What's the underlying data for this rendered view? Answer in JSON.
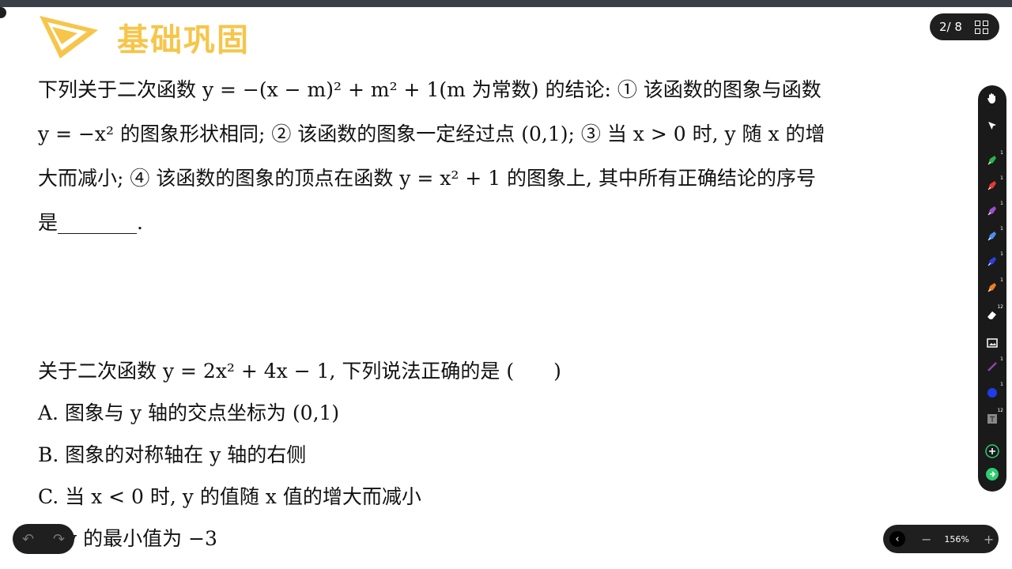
{
  "header": {
    "section_title": "基础巩固",
    "page_indicator": "2/ 8"
  },
  "question1": {
    "lines": [
      "下列关于二次函数 y = −(x − m)² + m² + 1(m 为常数) 的结论: ① 该函数的图象与函数",
      "y = −x² 的图象形状相同; ② 该函数的图象一定经过点 (0,1); ③ 当 x > 0 时, y 随 x 的增",
      "大而减小; ④ 该函数的图象的顶点在函数 y = x² + 1 的图象上, 其中所有正确结论的序号",
      "是________."
    ]
  },
  "question2": {
    "stem": "关于二次函数 y = 2x² + 4x − 1, 下列说法正确的是 (　　)",
    "options": [
      "A. 图象与 y 轴的交点坐标为 (0,1)",
      "B. 图象的对称轴在 y 轴的右侧",
      "C. 当 x < 0 时, y 的值随 x 值的增大而减小",
      "D. y 的最小值为 −3"
    ]
  },
  "tools": [
    {
      "name": "hand-tool",
      "icon": "hand-icon",
      "color": "#ffffff",
      "badge": ""
    },
    {
      "name": "select-tool",
      "icon": "pointer-icon",
      "color": "#ffffff",
      "badge": ""
    },
    {
      "name": "pen-green",
      "icon": "pen-icon",
      "color": "#2bb24c",
      "badge": "1"
    },
    {
      "name": "pen-red",
      "icon": "pen-icon",
      "color": "#e53935",
      "badge": "1"
    },
    {
      "name": "pen-purple",
      "icon": "pen-icon",
      "color": "#9c4dcc",
      "badge": "1"
    },
    {
      "name": "pen-lightblue",
      "icon": "pen-icon",
      "color": "#4a8cf0",
      "badge": "1"
    },
    {
      "name": "pen-blue",
      "icon": "pen-icon",
      "color": "#2d3fe0",
      "badge": "1"
    },
    {
      "name": "pen-orange",
      "icon": "pen-icon",
      "color": "#ef7d22",
      "badge": "1"
    },
    {
      "name": "eraser-tool",
      "icon": "eraser-icon",
      "color": "#ffffff",
      "badge": "12"
    },
    {
      "name": "image-tool",
      "icon": "image-icon",
      "color": "#ffffff",
      "badge": ""
    },
    {
      "name": "line-tool",
      "icon": "line-icon",
      "color": "#8e44ad",
      "badge": "1"
    },
    {
      "name": "shape-tool",
      "icon": "circle-icon",
      "color": "#1e3de6",
      "badge": "1"
    },
    {
      "name": "text-tool",
      "icon": "text-icon",
      "color": "#888888",
      "badge": "12"
    },
    {
      "name": "add-tool",
      "icon": "plus-icon",
      "color": "#2ecc71",
      "badge": ""
    },
    {
      "name": "exit-tool",
      "icon": "exit-icon",
      "color": "#2ecc71",
      "badge": ""
    }
  ],
  "zoom": {
    "back": "‹",
    "minus": "−",
    "level": "156%",
    "plus": "+"
  },
  "history": {
    "undo": "↶",
    "redo": "↷"
  }
}
